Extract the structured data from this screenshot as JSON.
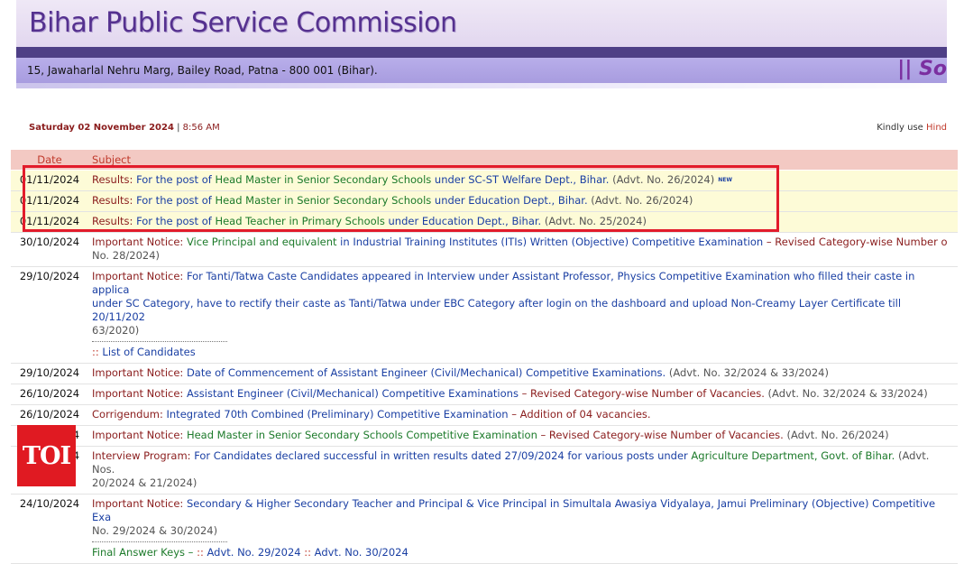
{
  "header": {
    "title": "Bihar Public Service Commission",
    "address": "15, Jawaharlal Nehru Marg, Bailey Road, Patna - 800 001 (Bihar).",
    "slogan_fragment": "|| So"
  },
  "dateline": {
    "day_date": "Saturday 02 November 2024",
    "separator": " | ",
    "time": "8:56 AM"
  },
  "kindly": {
    "prefix": "Kindly use ",
    "highlight": "Hind"
  },
  "table": {
    "headers": {
      "date": "Date",
      "subject": "Subject"
    },
    "rows": [
      {
        "date": "01/11/2024",
        "p1": "Results: ",
        "p2": "For the post of ",
        "p3": "Head Master in Senior Secondary Schools",
        "p4": " under SC-ST Welfare Dept., Bihar.",
        "p5": " (Advt. No. 26/2024)",
        "new": "NEW"
      },
      {
        "date": "01/11/2024",
        "p1": "Results: ",
        "p2": "For the post of ",
        "p3": "Head Master in Senior Secondary Schools",
        "p4": " under Education Dept., Bihar.",
        "p5": " (Advt. No. 26/2024)"
      },
      {
        "date": "01/11/2024",
        "p1": "Results: ",
        "p2": "For the post of ",
        "p3": "Head Teacher in Primary Schools",
        "p4": " under Education Dept., Bihar.",
        "p5": " (Advt. No. 25/2024)"
      },
      {
        "date": "30/10/2024",
        "p1": "Important Notice: ",
        "p2": "Vice Principal and equivalent",
        "p3": " in Industrial Training Institutes (ITIs) Written (Objective) Competitive Examination",
        "p4": " – Revised Category-wise Number o",
        "p5": "No. 28/2024)"
      },
      {
        "date": "29/10/2024",
        "p1": "Important Notice: ",
        "p2": "For Tanti/Tatwa Caste Candidates appeared in Interview under Assistant Professor, Physics Competitive Examination who filled their caste in applica",
        "p3": "under SC Category, have to rectify their caste as Tanti/Tatwa under EBC Category after login on the dashboard and upload Non-Creamy Layer Certificate till 20/11/202",
        "p4": "63/2020)",
        "sub_prefix": ":: ",
        "sub_label": "List of Candidates"
      },
      {
        "date": "29/10/2024",
        "p1": "Important Notice: ",
        "p2": "Date of Commencement of Assistant Engineer (Civil/Mechanical) Competitive Examinations.",
        "p5": " (Advt. No. 32/2024 & 33/2024)"
      },
      {
        "date": "26/10/2024",
        "p1": "Important Notice: ",
        "p2": "Assistant Engineer (Civil/Mechanical) Competitive Examinations",
        "p3": " – Revised Category-wise Number of Vacancies.",
        "p5": " (Advt. No. 32/2024 & 33/2024)"
      },
      {
        "date": "26/10/2024",
        "p1": "Corrigendum: ",
        "p2": "Integrated 70th Combined (Preliminary) Competitive Examination",
        "p3": " – Addition of 04 vacancies."
      },
      {
        "date": "25/10/2024",
        "p1": "Important Notice: ",
        "p2": "Head Master in Senior Secondary Schools Competitive Examination",
        "p3": " – Revised Category-wise Number of Vacancies.",
        "p5": " (Advt. No. 26/2024)"
      },
      {
        "date": "24/10/2024",
        "p1": "Interview Program: ",
        "p2": "For Candidates declared successful in written results dated 27/09/2024 for various posts under ",
        "p3": "Agriculture Department, Govt. of Bihar.",
        "p4": " (Advt. Nos.",
        "p5": "20/2024 & 21/2024)"
      },
      {
        "date": "24/10/2024",
        "p1": "Important Notice: ",
        "p2": "Secondary & Higher Secondary Teacher and Principal & Vice Principal in Simultala Awasiya Vidyalaya, Jamui Preliminary (Objective) Competitive Exa",
        "p5": "No. 29/2024 & 30/2024)",
        "sub2_label": "Final Answer Keys – ",
        "sub2_sep": ":: ",
        "sub2_link1": "Advt. No. 29/2024",
        "sub2_link2": "Advt. No. 30/2024"
      }
    ]
  },
  "watermark": {
    "text": "TOI"
  },
  "highlight_color": "#e21b2b"
}
